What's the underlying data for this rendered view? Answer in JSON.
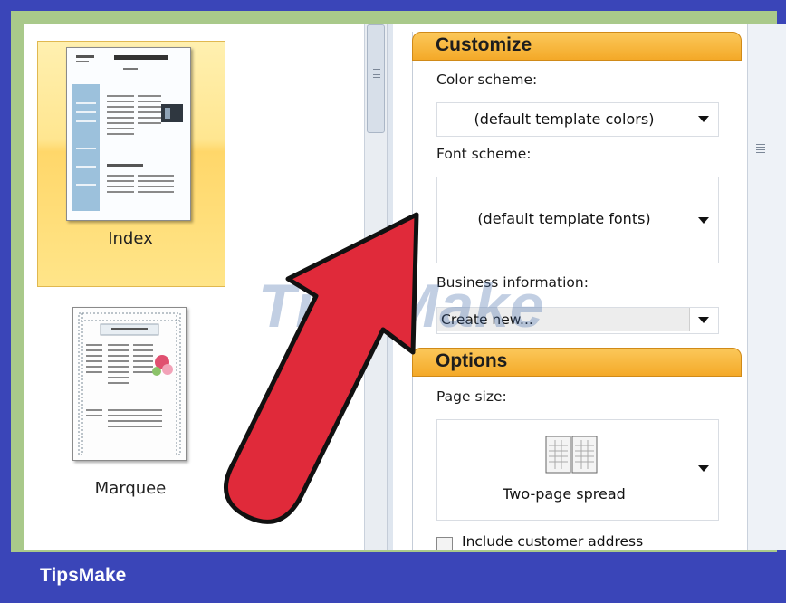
{
  "gallery": {
    "templates": [
      {
        "label": "Index",
        "selected": true
      },
      {
        "label": "Marquee",
        "selected": false
      }
    ]
  },
  "customize": {
    "header": "Customize",
    "color_scheme_label": "Color scheme:",
    "color_scheme_value": "(default template colors)",
    "font_scheme_label": "Font scheme:",
    "font_scheme_value": "(default template fonts)",
    "business_info_label": "Business information:",
    "business_info_value": "Create new..."
  },
  "options": {
    "header": "Options",
    "page_size_label": "Page size:",
    "page_size_value": "Two-page spread",
    "include_address_label": "Include customer address",
    "include_address_checked": false
  },
  "watermark": "TipsMake",
  "banner": {
    "title": "TipsMake"
  },
  "colors": {
    "banner": "#3a45b8",
    "section_header": "#f7b43a",
    "selected_tile": "#ffe590",
    "arrow": "#e02a3a"
  }
}
